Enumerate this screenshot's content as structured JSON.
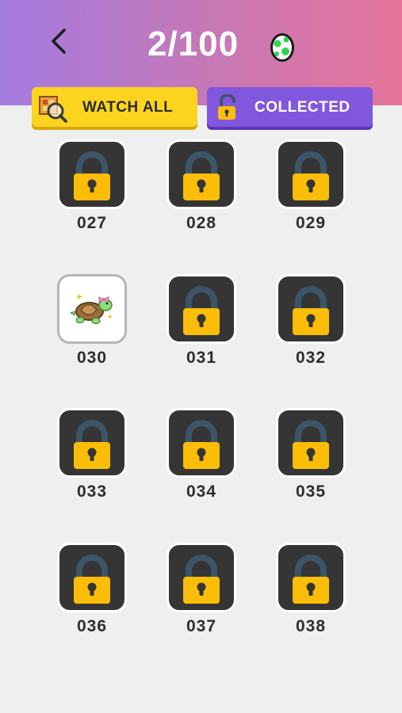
{
  "header": {
    "counter": "2/100",
    "back_icon": "chevron-left-icon",
    "egg_icon": "green-spotted-egg-icon"
  },
  "tabs": {
    "watch_all": {
      "label": "WATCH ALL",
      "icon": "magnifier-pixel-icon"
    },
    "collected": {
      "label": "COLLECTED",
      "icon": "open-padlock-icon"
    }
  },
  "colors": {
    "watch_tab": "#fcd41f",
    "collected_tab": "#8157de",
    "lock_body": "#fbbd08",
    "lock_tile": "#353535"
  },
  "items": [
    {
      "number": "027",
      "state": "locked"
    },
    {
      "number": "028",
      "state": "locked"
    },
    {
      "number": "029",
      "state": "locked"
    },
    {
      "number": "030",
      "state": "unlocked",
      "icon": "turtle-with-bow-icon"
    },
    {
      "number": "031",
      "state": "locked"
    },
    {
      "number": "032",
      "state": "locked"
    },
    {
      "number": "033",
      "state": "locked"
    },
    {
      "number": "034",
      "state": "locked"
    },
    {
      "number": "035",
      "state": "locked"
    },
    {
      "number": "036",
      "state": "locked"
    },
    {
      "number": "037",
      "state": "locked"
    },
    {
      "number": "038",
      "state": "locked"
    }
  ]
}
